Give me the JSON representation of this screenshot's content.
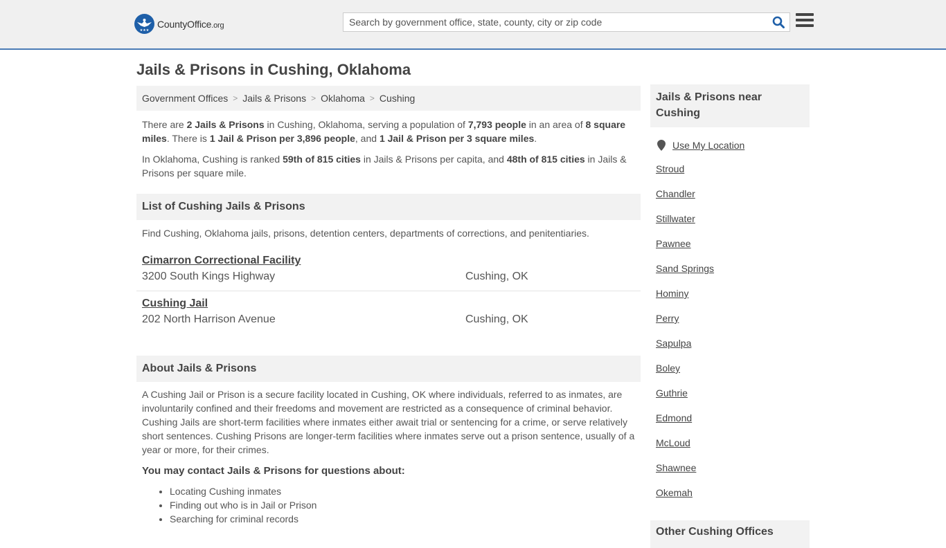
{
  "header": {
    "logo_main": "CountyOffice",
    "logo_tld": ".org",
    "search_placeholder": "Search by government office, state, county, city or zip code",
    "search_value": "",
    "colors": {
      "accent": "#4a7bb5",
      "logo_blue": "#1e5fa8",
      "search_icon": "#1e5fa8"
    }
  },
  "page_title": "Jails & Prisons in Cushing, Oklahoma",
  "breadcrumb": [
    "Government Offices",
    "Jails & Prisons",
    "Oklahoma",
    "Cushing"
  ],
  "intro": {
    "p1": [
      {
        "t": "There are ",
        "b": false
      },
      {
        "t": "2 Jails & Prisons",
        "b": true
      },
      {
        "t": " in Cushing, Oklahoma, serving a population of ",
        "b": false
      },
      {
        "t": "7,793 people",
        "b": true
      },
      {
        "t": " in an area of ",
        "b": false
      },
      {
        "t": "8 square miles",
        "b": true
      },
      {
        "t": ". There is ",
        "b": false
      },
      {
        "t": "1 Jail & Prison per 3,896 people",
        "b": true
      },
      {
        "t": ", and ",
        "b": false
      },
      {
        "t": "1 Jail & Prison per 3 square miles",
        "b": true
      },
      {
        "t": ".",
        "b": false
      }
    ],
    "p2": [
      {
        "t": "In Oklahoma, Cushing is ranked ",
        "b": false
      },
      {
        "t": "59th of 815 cities",
        "b": true
      },
      {
        "t": " in Jails & Prisons per capita, and ",
        "b": false
      },
      {
        "t": "48th of 815 cities",
        "b": true
      },
      {
        "t": " in Jails & Prisons per square mile.",
        "b": false
      }
    ]
  },
  "list": {
    "heading": "List of Cushing Jails & Prisons",
    "description": "Find Cushing, Oklahoma jails, prisons, detention centers, departments of corrections, and penitentiaries.",
    "facilities": [
      {
        "name": "Cimarron Correctional Facility",
        "address": "3200 South Kings Highway",
        "city": "Cushing, OK"
      },
      {
        "name": "Cushing Jail",
        "address": "202 North Harrison Avenue",
        "city": "Cushing, OK"
      }
    ]
  },
  "about": {
    "heading": "About Jails & Prisons",
    "text": "A Cushing Jail or Prison is a secure facility located in Cushing, OK where individuals, referred to as inmates, are involuntarily confined and their freedoms and movement are restricted as a consequence of criminal behavior. Cushing Jails are short-term facilities where inmates either await trial or sentencing for a crime, or serve relatively short sentences. Cushing Prisons are longer-term facilities where inmates serve out a prison sentence, usually of a year or more, for their crimes.",
    "contact_heading": "You may contact Jails & Prisons for questions about:",
    "bullets": [
      "Locating Cushing inmates",
      "Finding out who is in Jail or Prison",
      "Searching for criminal records"
    ]
  },
  "sidebar": {
    "heading": "Jails & Prisons near Cushing",
    "use_location": "Use My Location",
    "cities": [
      "Stroud",
      "Chandler",
      "Stillwater",
      "Pawnee",
      "Sand Springs",
      "Hominy",
      "Perry",
      "Sapulpa",
      "Boley",
      "Guthrie",
      "Edmond",
      "McLoud",
      "Shawnee",
      "Okemah"
    ],
    "other_heading": "Other Cushing Offices"
  }
}
